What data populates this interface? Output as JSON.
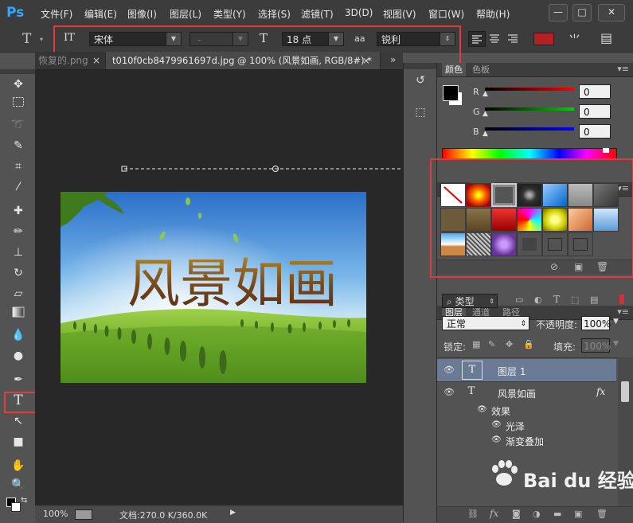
{
  "app": {
    "logo": "Ps",
    "accent": "#31a8ff"
  },
  "menu": [
    "文件(F)",
    "编辑(E)",
    "图像(I)",
    "图层(L)",
    "类型(Y)",
    "选择(S)",
    "滤镜(T)",
    "3D(D)",
    "视图(V)",
    "窗口(W)",
    "帮助(H)"
  ],
  "window_controls": {
    "minimize": "—",
    "restore": "□",
    "close": "✕"
  },
  "options": {
    "tool_glyph": "T",
    "orient_glyph": "IT",
    "font_family": "宋体",
    "font_style": "-",
    "size_glyph": "T",
    "font_size": "18 点",
    "aa_glyph": "aa",
    "antialias": "锐利",
    "color": "#b52020",
    "warp_glyph": "⺌",
    "panel_glyph": "▤"
  },
  "tabs": [
    {
      "label": "恢复的.png",
      "close": "×"
    },
    {
      "label": "t010f0cb8479961697d.jpg @ 100% (风景如画, RGB/8#) *",
      "close": "×"
    }
  ],
  "tab_overflow": "»",
  "canvas": {
    "text": "风景如画"
  },
  "status": {
    "zoom": "100%",
    "doc": "文档:270.0 K/360.0K",
    "arrow": "▶"
  },
  "color_panel": {
    "tabs": [
      "颜色",
      "色板"
    ],
    "r_label": "R",
    "g_label": "G",
    "b_label": "B",
    "r": "0",
    "g": "0",
    "b": "0"
  },
  "styles_panel": {
    "tabs": [
      "调整",
      "样式"
    ]
  },
  "layers_panel": {
    "tabs": [
      "图层",
      "通道",
      "路径"
    ],
    "filter": "类型",
    "blend": "正常",
    "opacity_label": "不透明度:",
    "opacity": "100%",
    "lock_label": "锁定:",
    "fill_label": "填充:",
    "fill": "100%",
    "layers": [
      {
        "name": "图层 1",
        "selected": true
      },
      {
        "name": "风景如画",
        "fx": "fx"
      }
    ],
    "effects_label": "效果",
    "effects": [
      "光泽",
      "渐变叠加"
    ],
    "bottom_icons": [
      "link-icon",
      "fx-icon",
      "mask-icon",
      "adjustment-icon",
      "group-icon",
      "new-layer-icon",
      "trash-icon"
    ]
  },
  "watermark": "Bai du 经验"
}
